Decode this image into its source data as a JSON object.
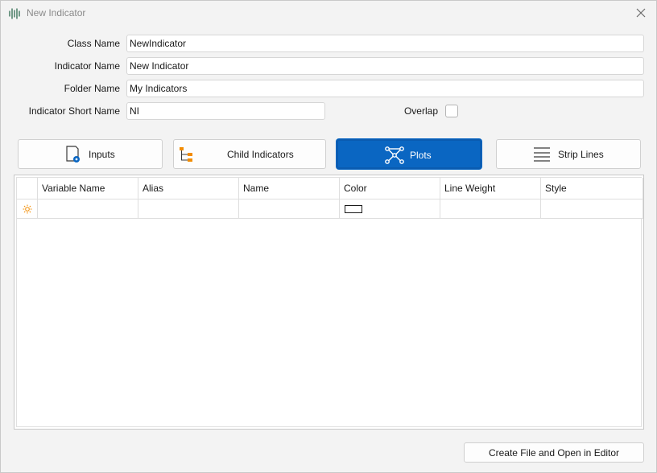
{
  "window": {
    "title": "New Indicator",
    "app_icon": "waveform-icon",
    "close_icon": "close-icon"
  },
  "form": {
    "class_name": {
      "label": "Class Name",
      "value": "NewIndicator"
    },
    "indicator_name": {
      "label": "Indicator Name",
      "value": "New Indicator"
    },
    "folder_name": {
      "label": "Folder Name",
      "value": "My Indicators"
    },
    "short_name": {
      "label": "Indicator Short Name",
      "value": "NI"
    },
    "overlap": {
      "label": "Overlap",
      "checked": false
    }
  },
  "tabs": [
    {
      "label": "Inputs",
      "icon": "document-gear-icon",
      "active": false
    },
    {
      "label": "Child Indicators",
      "icon": "hierarchy-icon",
      "active": false
    },
    {
      "label": "Plots",
      "icon": "network-plot-icon",
      "active": true
    },
    {
      "label": "Strip Lines",
      "icon": "lines-icon",
      "active": false
    }
  ],
  "grid": {
    "columns": [
      "Variable Name",
      "Alias",
      "Name",
      "Color",
      "Line Weight",
      "Style"
    ],
    "new_row_icon": "sun-new-row-icon",
    "rows": [
      {
        "Variable Name": "",
        "Alias": "",
        "Name": "",
        "Color": "#ffffff",
        "Line Weight": "",
        "Style": ""
      }
    ]
  },
  "footer": {
    "create_label": "Create File and Open in Editor"
  },
  "colors": {
    "accent": "#0a66c2",
    "orange": "#f28c00"
  }
}
